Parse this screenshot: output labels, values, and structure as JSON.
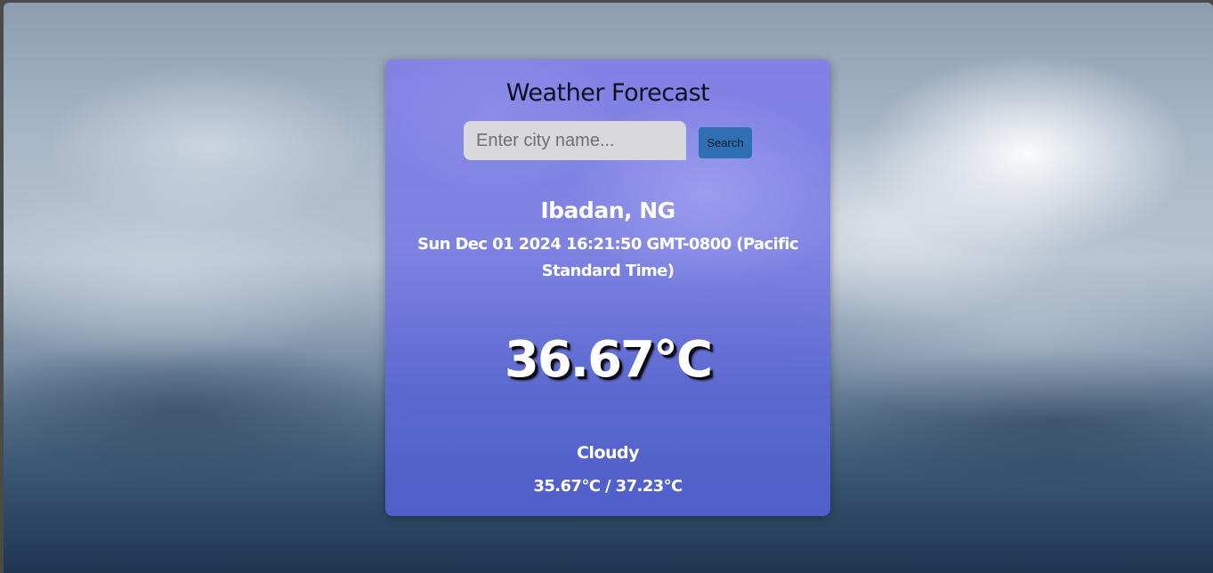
{
  "app": {
    "title": "Weather Forecast"
  },
  "search": {
    "placeholder": "Enter city name...",
    "value": "",
    "button_label": "Search"
  },
  "weather": {
    "location": "Ibadan, NG",
    "datetime": "Sun Dec 01 2024 16:21:50 GMT-0800 (Pacific Standard Time)",
    "temperature": "36.67°C",
    "condition": "Cloudy",
    "min_max": "35.67°C / 37.23°C"
  },
  "colors": {
    "card_tint": "#7b7de6",
    "search_button": "#2f6fb3",
    "input_bg": "#d9d8dc"
  }
}
